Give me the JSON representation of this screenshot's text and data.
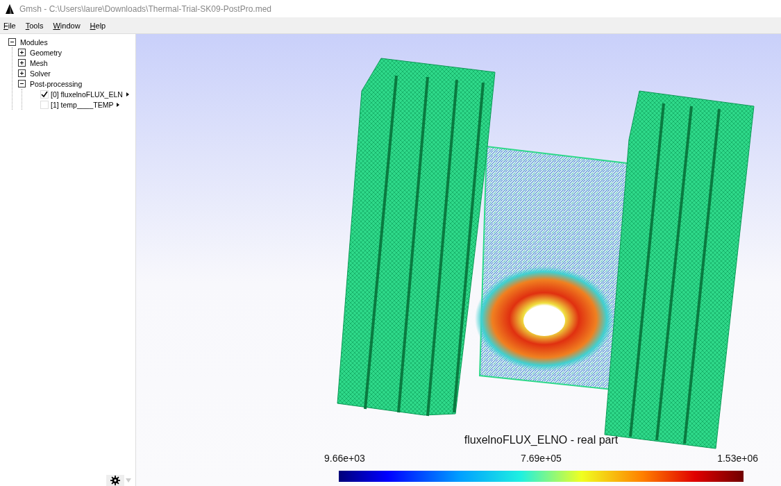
{
  "window": {
    "title": "Gmsh - C:\\Users\\laure\\Downloads\\Thermal-Trial-SK09-PostPro.med"
  },
  "menu": [
    "File",
    "Tools",
    "Window",
    "Help"
  ],
  "tree": [
    {
      "kind": "module",
      "label": "Modules",
      "expanded": true,
      "children": [
        {
          "kind": "module",
          "label": "Geometry",
          "expanded": false
        },
        {
          "kind": "module",
          "label": "Mesh",
          "expanded": false
        },
        {
          "kind": "module",
          "label": "Solver",
          "expanded": false
        },
        {
          "kind": "module",
          "label": "Post-processing",
          "expanded": true,
          "children": [
            {
              "kind": "view",
              "label": "[0] fluxelnoFLUX_ELN",
              "checked": true
            },
            {
              "kind": "view",
              "label": "[1] temp____TEMP",
              "checked": false
            }
          ]
        }
      ]
    }
  ],
  "scale": {
    "title": "fluxelnoFLUX_ELNO - real part",
    "min": "9.66e+03",
    "mid": "7.69e+05",
    "max": "1.53e+06"
  }
}
